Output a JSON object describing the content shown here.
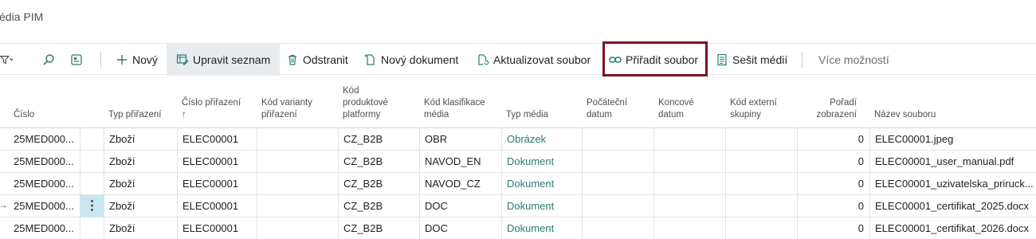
{
  "page": {
    "title": "édia PIM"
  },
  "toolbar": {
    "new_label": "Nový",
    "edit_list_label": "Upravit seznam",
    "delete_label": "Odstranit",
    "new_document_label": "Nový dokument",
    "update_file_label": "Aktualizovat soubor",
    "assign_file_label": "Přiřadit soubor",
    "media_workbook_label": "Sešit médií",
    "more_options_label": "Více možností"
  },
  "table": {
    "headers": {
      "cislo": "Číslo",
      "typ_prirazeni": "Typ přiřazení",
      "cislo_prirazeni": "Číslo přiřazení",
      "sort_arrow": "↑",
      "kod_varianty": "Kód varianty přiřazení",
      "kod_platformy": "Kód produktové platformy",
      "kod_klasifikace": "Kód klasifikace média",
      "typ_media": "Typ média",
      "pocatecni_datum": "Počáteční datum",
      "koncove_datum": "Koncové datum",
      "kod_externi_skupiny": "Kód externí skupiny",
      "poradi": "Pořadí zobrazení",
      "nazev_souboru": "Název souboru"
    },
    "rows": [
      {
        "cislo": "25MED000...",
        "typ": "Zboží",
        "cislo_prirazeni": "ELEC00001",
        "varianta": "",
        "platforma": "CZ_B2B",
        "klasifikace": "OBR",
        "typ_media": "Obrázek",
        "pocatecni": "",
        "koncove": "",
        "externi": "",
        "poradi": "0",
        "soubor": "ELEC00001.jpeg"
      },
      {
        "cislo": "25MED000...",
        "typ": "Zboží",
        "cislo_prirazeni": "ELEC00001",
        "varianta": "",
        "platforma": "CZ_B2B",
        "klasifikace": "NAVOD_EN",
        "typ_media": "Dokument",
        "pocatecni": "",
        "koncove": "",
        "externi": "",
        "poradi": "0",
        "soubor": "ELEC00001_user_manual.pdf"
      },
      {
        "cislo": "25MED000...",
        "typ": "Zboží",
        "cislo_prirazeni": "ELEC00001",
        "varianta": "",
        "platforma": "CZ_B2B",
        "klasifikace": "NAVOD_CZ",
        "typ_media": "Dokument",
        "pocatecni": "",
        "koncove": "",
        "externi": "",
        "poradi": "0",
        "soubor": "ELEC00001_uzivatelska_priruck..."
      },
      {
        "cislo": "25MED000...",
        "typ": "Zboží",
        "cislo_prirazeni": "ELEC00001",
        "varianta": "",
        "platforma": "CZ_B2B",
        "klasifikace": "DOC",
        "typ_media": "Dokument",
        "pocatecni": "",
        "koncove": "",
        "externi": "",
        "poradi": "0",
        "soubor": "ELEC00001_certifikat_2025.docx"
      },
      {
        "cislo": "25MED000...",
        "typ": "Zboží",
        "cislo_prirazeni": "ELEC00001",
        "varianta": "",
        "platforma": "CZ_B2B",
        "klasifikace": "DOC",
        "typ_media": "Dokument",
        "pocatecni": "",
        "koncove": "",
        "externi": "",
        "poradi": "0",
        "soubor": "ELEC00001_certifikat_2026.docx"
      }
    ],
    "selected_row_marker": "→",
    "row_menu_glyph": "⋮"
  },
  "colors": {
    "accent_link": "#2c7a72",
    "highlight_border": "#7a1327",
    "selected_cell": "#c5e7ef"
  }
}
